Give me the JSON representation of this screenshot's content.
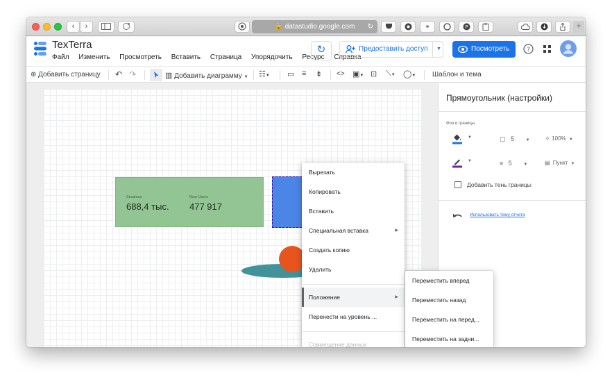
{
  "browser": {
    "url": "datastudio.google.com",
    "lock_icon": "lock-icon"
  },
  "app": {
    "title": "TexTerra",
    "share_label": "Предоставить доступ",
    "view_label": "Посмотреть",
    "accent": "#1a73e8"
  },
  "menu": [
    "Файл",
    "Изменить",
    "Просмотреть",
    "Вставить",
    "Страница",
    "Упорядочить",
    "Ресурс",
    "Справка"
  ],
  "toolbar": {
    "add_page": "Добавить страницу",
    "add_chart": "Добавить диаграмму",
    "theme": "Шаблон и тема"
  },
  "scorecard": {
    "metric1_label": "Sessions",
    "metric1_value": "688,4 тыс.",
    "metric2_label": "New Users",
    "metric2_value": "477 917",
    "fill": "#93c594"
  },
  "panel": {
    "title": "Прямоугольник (настройки)",
    "section": "Фон и границы",
    "fill_weight": "5",
    "opacity": "100%",
    "border_weight": "5",
    "border_style": "Пункт",
    "shadow_label": "Добавить тень границы",
    "use_theme_link": "Использовать тему отчета"
  },
  "context_menu": {
    "items": [
      "Вырезать",
      "Копировать",
      "Вставить",
      "Специальная вставка",
      "Создать копию",
      "Удалить",
      "Положение",
      "Перенести на уровень ...",
      "Совмещение данных"
    ]
  },
  "submenu": {
    "items": [
      "Переместить вперед",
      "Переместить назад",
      "Переместить на перед...",
      "Переместить на задни..."
    ]
  }
}
